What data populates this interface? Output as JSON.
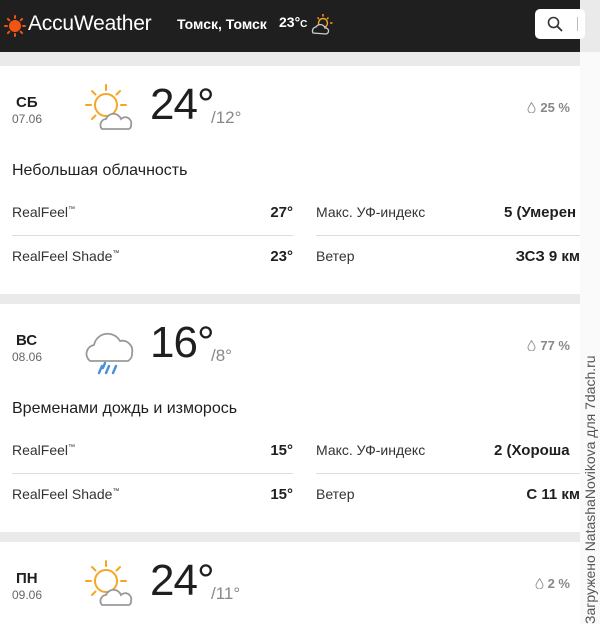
{
  "header": {
    "brand": "AccuWeather",
    "location": "Томск, Томск",
    "current_temp": "23°",
    "current_temp_unit": "C"
  },
  "days": [
    {
      "dow": "СБ",
      "date": "07.06",
      "hi": "24°",
      "lo": "/12°",
      "precip": "25 %",
      "phrase": "Небольшая облачность",
      "realfeel_label": "RealFeel",
      "realfeel": "27°",
      "realfeel_shade_label": "RealFeel Shade",
      "realfeel_shade": "23°",
      "uv_label": "Макс. УФ-индекс",
      "uv": "5 (Умерен",
      "wind_label": "Ветер",
      "wind": "ЗСЗ 9 км"
    },
    {
      "dow": "ВС",
      "date": "08.06",
      "hi": "16°",
      "lo": "/8°",
      "precip": "77 %",
      "phrase": "Временами дождь и изморось",
      "realfeel_label": "RealFeel",
      "realfeel": "15°",
      "realfeel_shade_label": "RealFeel Shade",
      "realfeel_shade": "15°",
      "uv_label": "Макс. УФ-индекс",
      "uv": "2 (Хороша",
      "wind_label": "Ветер",
      "wind": "С 11 км"
    },
    {
      "dow": "ПН",
      "date": "09.06",
      "hi": "24°",
      "lo": "/11°",
      "precip": "2 %"
    }
  ],
  "trademark": "™",
  "watermark": "Загружено NatashaNovikova для 7dach.ru",
  "colors": {
    "header_bg": "#1f1f1f",
    "brand_orange": "#f05514",
    "sun_orange": "#f6a623"
  }
}
